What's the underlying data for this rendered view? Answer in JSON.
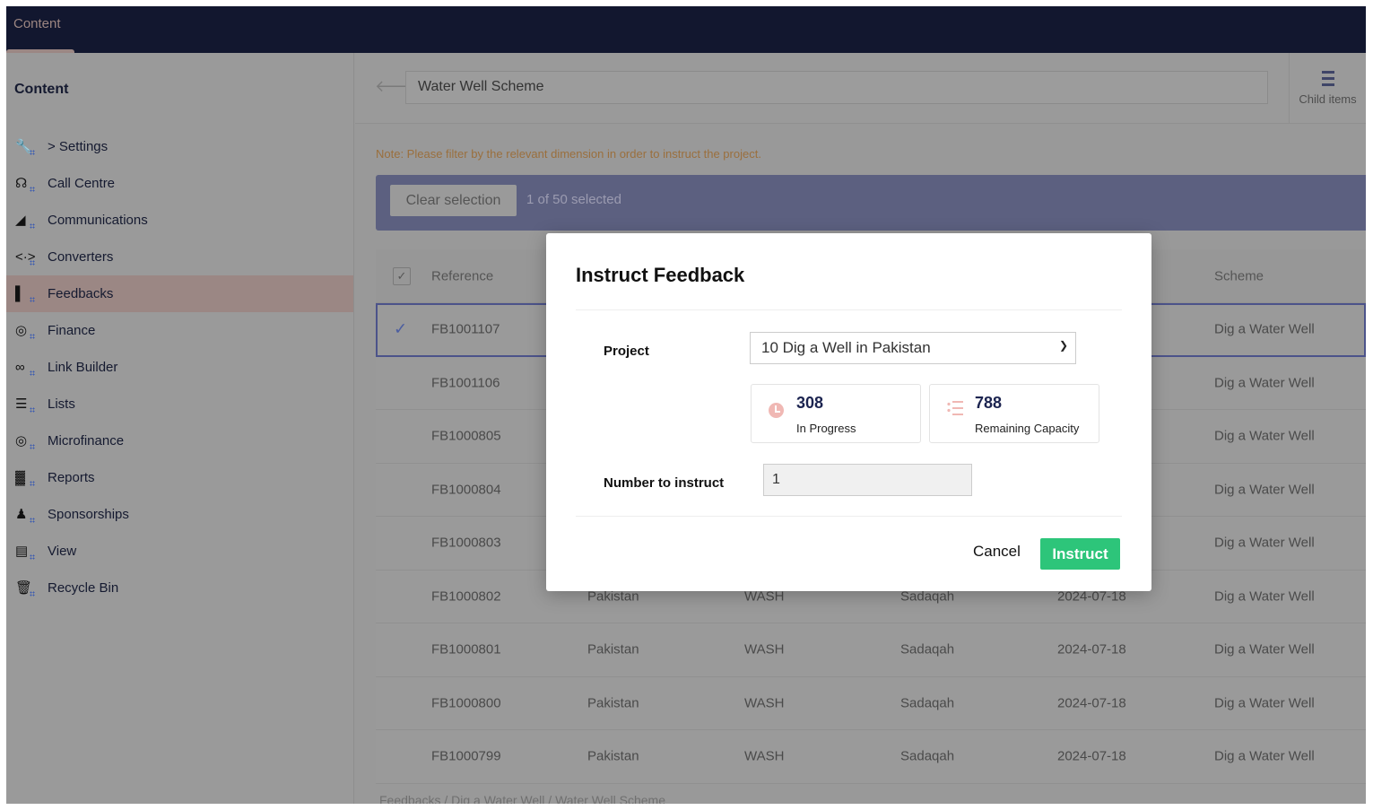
{
  "topbar": {
    "tab": "Content"
  },
  "sidebar": {
    "title": "Content",
    "items": [
      {
        "label": "> Settings",
        "icon": "wrench-icon"
      },
      {
        "label": "Call Centre",
        "icon": "headset-icon"
      },
      {
        "label": "Communications",
        "icon": "communications-icon"
      },
      {
        "label": "Converters",
        "icon": "converter-icon"
      },
      {
        "label": "Feedbacks",
        "icon": "feedback-icon",
        "active": true
      },
      {
        "label": "Finance",
        "icon": "finance-icon"
      },
      {
        "label": "Link Builder",
        "icon": "link-icon"
      },
      {
        "label": "Lists",
        "icon": "list-icon"
      },
      {
        "label": "Microfinance",
        "icon": "microfinance-icon"
      },
      {
        "label": "Reports",
        "icon": "reports-icon"
      },
      {
        "label": "Sponsorships",
        "icon": "sponsorship-icon"
      },
      {
        "label": "View",
        "icon": "view-icon"
      },
      {
        "label": "Recycle Bin",
        "icon": "trash-icon"
      }
    ]
  },
  "header": {
    "title": "Water Well Scheme",
    "child_items": "Child items"
  },
  "note": "Note: Please filter by the relevant dimension in order to instruct the project.",
  "selection": {
    "clear": "Clear selection",
    "count": "1 of 50 selected"
  },
  "table": {
    "headers": [
      "Reference",
      "Scheme"
    ],
    "rows": [
      {
        "ref": "FB1001107",
        "scheme": "Dig a Water Well",
        "selected": true
      },
      {
        "ref": "FB1001106",
        "scheme": "Dig a Water Well"
      },
      {
        "ref": "FB1000805",
        "scheme": "Dig a Water Well"
      },
      {
        "ref": "FB1000804",
        "scheme": "Dig a Water Well"
      },
      {
        "ref": "FB1000803",
        "scheme": "Dig a Water Well"
      },
      {
        "ref": "FB1000802",
        "country": "Pakistan",
        "category": "WASH",
        "type": "Sadaqah",
        "date": "2024-07-18",
        "scheme": "Dig a Water Well"
      },
      {
        "ref": "FB1000801",
        "country": "Pakistan",
        "category": "WASH",
        "type": "Sadaqah",
        "date": "2024-07-18",
        "scheme": "Dig a Water Well"
      },
      {
        "ref": "FB1000800",
        "country": "Pakistan",
        "category": "WASH",
        "type": "Sadaqah",
        "date": "2024-07-18",
        "scheme": "Dig a Water Well"
      },
      {
        "ref": "FB1000799",
        "country": "Pakistan",
        "category": "WASH",
        "type": "Sadaqah",
        "date": "2024-07-18",
        "scheme": "Dig a Water Well"
      }
    ]
  },
  "breadcrumb": "Feedbacks / Dig a Water Well / Water Well Scheme",
  "modal": {
    "title": "Instruct Feedback",
    "project_label": "Project",
    "project_value": "10 Dig a Well in Pakistan",
    "stats": [
      {
        "value": "308",
        "label": "In Progress"
      },
      {
        "value": "788",
        "label": "Remaining Capacity"
      }
    ],
    "number_label": "Number to instruct",
    "number_value": "1",
    "cancel": "Cancel",
    "instruct": "Instruct"
  },
  "colors": {
    "accent": "#2dc57a",
    "topbar": "#12172f",
    "selection_bar": "#5c6080"
  }
}
